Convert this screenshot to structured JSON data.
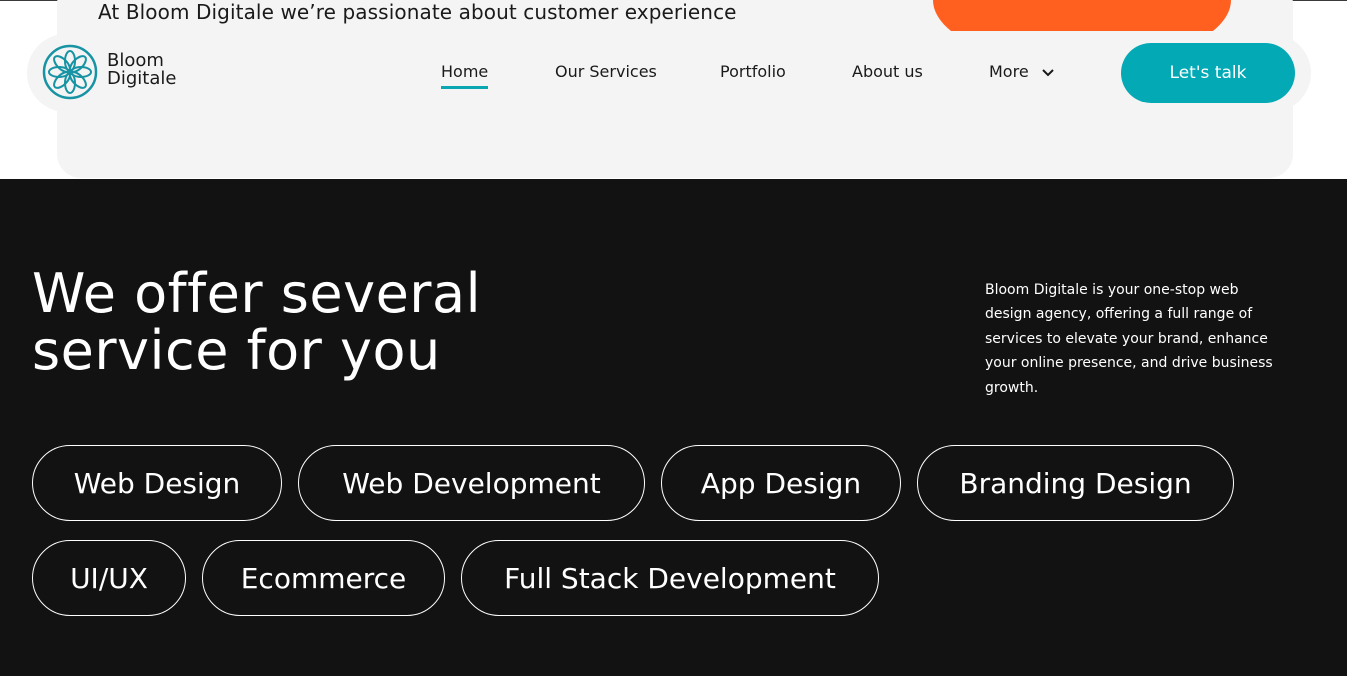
{
  "hero": {
    "tagline": "At Bloom Digitale we’re passionate about customer experience"
  },
  "brand": {
    "name_line1": "Bloom",
    "name_line2": "Digitale",
    "logo_icon": "flower-mandala-icon",
    "accent_color": "#03a9b5",
    "orange_color": "#ff5f1f"
  },
  "nav": {
    "items": [
      {
        "label": "Home",
        "active": true
      },
      {
        "label": "Our Services"
      },
      {
        "label": "Portfolio"
      },
      {
        "label": "About us"
      },
      {
        "label": "More",
        "icon": "chevron-down-icon"
      }
    ],
    "cta_label": "Let's talk"
  },
  "services": {
    "heading_line1": "We offer several",
    "heading_line2": "service for you",
    "description": "Bloom Digitale is your one-stop web design agency, offering a full range of services to elevate your brand, enhance your online presence, and drive business growth.",
    "pills": [
      "Web Design",
      "Web Development",
      "App Design",
      "Branding Design",
      "UI/UX",
      "Ecommerce",
      "Full Stack Development"
    ]
  }
}
